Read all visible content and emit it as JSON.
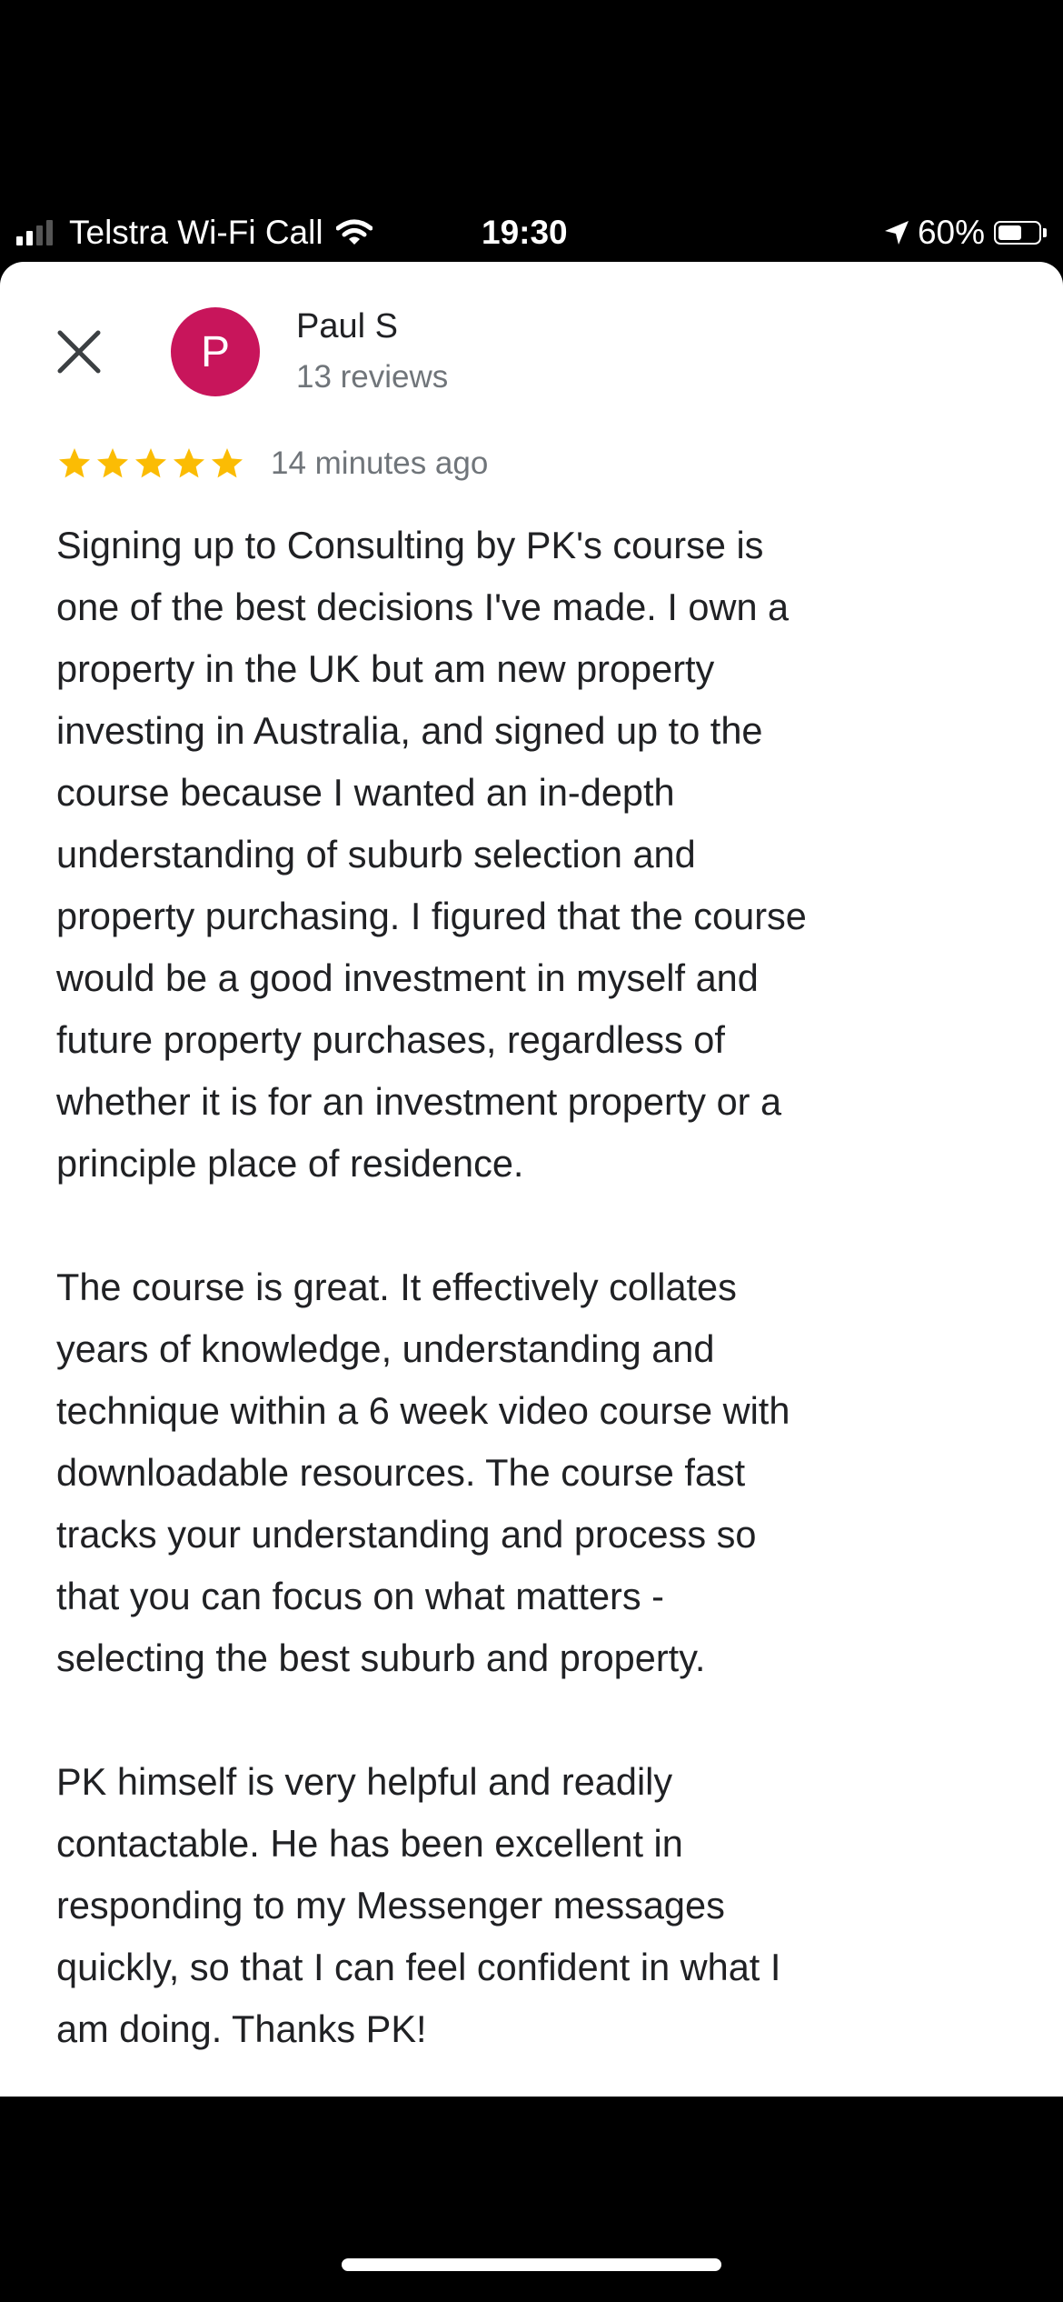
{
  "status_bar": {
    "carrier": "Telstra Wi-Fi Call",
    "time": "19:30",
    "battery": "60%",
    "battery_level": 0.6,
    "signal_bars_active": 2,
    "signal_bars_total": 4,
    "icons": [
      "signal-icon",
      "wifi-icon",
      "location-arrow-icon",
      "battery-icon"
    ]
  },
  "review": {
    "close_icon": "close-icon",
    "avatar_letter": "P",
    "avatar_color": "#c8155b",
    "reviewer_name": "Paul S",
    "reviewer_reviews": "13 reviews",
    "rating": 5,
    "rating_max": 5,
    "star_color": "#fbbc04",
    "time_ago": "14 minutes ago",
    "paragraphs": [
      "Signing up to Consulting by PK's course is\none of the best decisions I've made. I own a\nproperty in the UK but am new property\ninvesting in Australia, and signed up to the\ncourse because I wanted an in-depth\nunderstanding of suburb selection and\nproperty purchasing. I figured that the course\nwould be a good investment in myself and\nfuture property purchases, regardless of\nwhether it is for an investment property or a\nprinciple place of residence.",
      "The course is great. It effectively collates\nyears of knowledge, understanding and\ntechnique within a 6 week video course with\ndownloadable resources. The course fast\ntracks your understanding and process so\nthat you can focus on what matters -\nselecting the best suburb and property.",
      "PK himself is very helpful and readily\ncontactable. He has been excellent in\nresponding to my Messenger messages\nquickly, so that I can feel confident in what I\nam doing. Thanks PK!"
    ]
  }
}
